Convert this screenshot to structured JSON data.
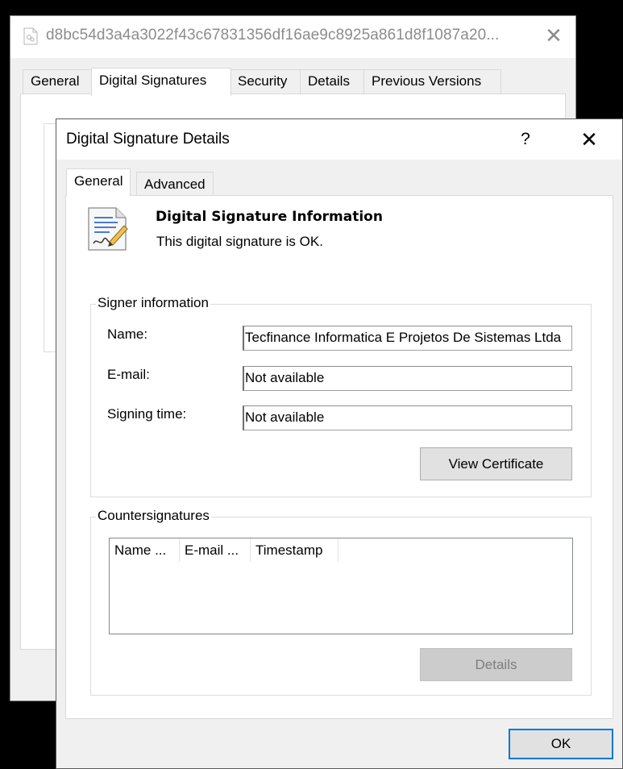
{
  "background_window": {
    "title": "d8bc54d3a4a3022f43c67831356df16ae9c8925a861d8f1087a20...",
    "close_glyph": "✕",
    "tabs": [
      {
        "label": "General"
      },
      {
        "label": "Digital Signatures",
        "selected": true
      },
      {
        "label": "Security"
      },
      {
        "label": "Details"
      },
      {
        "label": "Previous Versions"
      }
    ]
  },
  "dialog": {
    "title": "Digital Signature Details",
    "help_glyph": "?",
    "close_glyph": "✕",
    "tabs": [
      {
        "label": "General",
        "selected": true
      },
      {
        "label": "Advanced"
      }
    ],
    "info": {
      "heading": "Digital Signature Information",
      "status": "This digital signature is OK."
    },
    "signer": {
      "group_label": "Signer information",
      "name_label": "Name:",
      "name_value": "Tecfinance Informatica E Projetos De Sistemas Ltda",
      "email_label": "E-mail:",
      "email_value": "Not available",
      "time_label": "Signing time:",
      "time_value": "Not available",
      "view_certificate_label": "View Certificate"
    },
    "countersignatures": {
      "group_label": "Countersignatures",
      "columns": [
        "Name ...",
        "E-mail ...",
        "Timestamp"
      ],
      "rows": [],
      "details_label": "Details",
      "details_enabled": false
    },
    "ok_label": "OK"
  },
  "colors": {
    "accent": "#0078d7",
    "window_bg": "#f0f0f0",
    "disabled_text": "#7d7d7d"
  },
  "icons": [
    "document-icon",
    "certificate-icon",
    "close-icon",
    "help-icon"
  ]
}
